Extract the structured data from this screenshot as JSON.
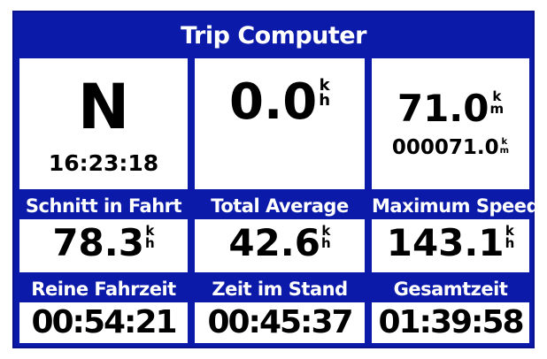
{
  "screen": {
    "title": "Trip Computer"
  },
  "top": {
    "heading": {
      "value": "N",
      "time": "16:23:18"
    },
    "speed": {
      "value": "0.0",
      "unit_top": "k",
      "unit_bottom": "h"
    },
    "odometer": {
      "value": "71.0",
      "unit_top": "k",
      "unit_bottom": "m",
      "total": "000071.0",
      "total_unit_top": "k",
      "total_unit_bottom": "m"
    }
  },
  "stats": [
    {
      "label": "Schnitt in Fahrt",
      "value": "78.3",
      "unit_top": "k",
      "unit_bottom": "h"
    },
    {
      "label": "Total Average",
      "value": "42.6",
      "unit_top": "k",
      "unit_bottom": "h"
    },
    {
      "label": "Maximum Speed",
      "value": "143.1",
      "unit_top": "k",
      "unit_bottom": "h"
    }
  ],
  "times": [
    {
      "label": "Reine Fahrzeit",
      "value": "00:54:21"
    },
    {
      "label": "Zeit im Stand",
      "value": "00:45:37"
    },
    {
      "label": "Gesamtzeit",
      "value": "01:39:58"
    }
  ],
  "colors": {
    "background": "#0b1aa8",
    "panel": "#ffffff",
    "label_text": "#ffffff"
  }
}
